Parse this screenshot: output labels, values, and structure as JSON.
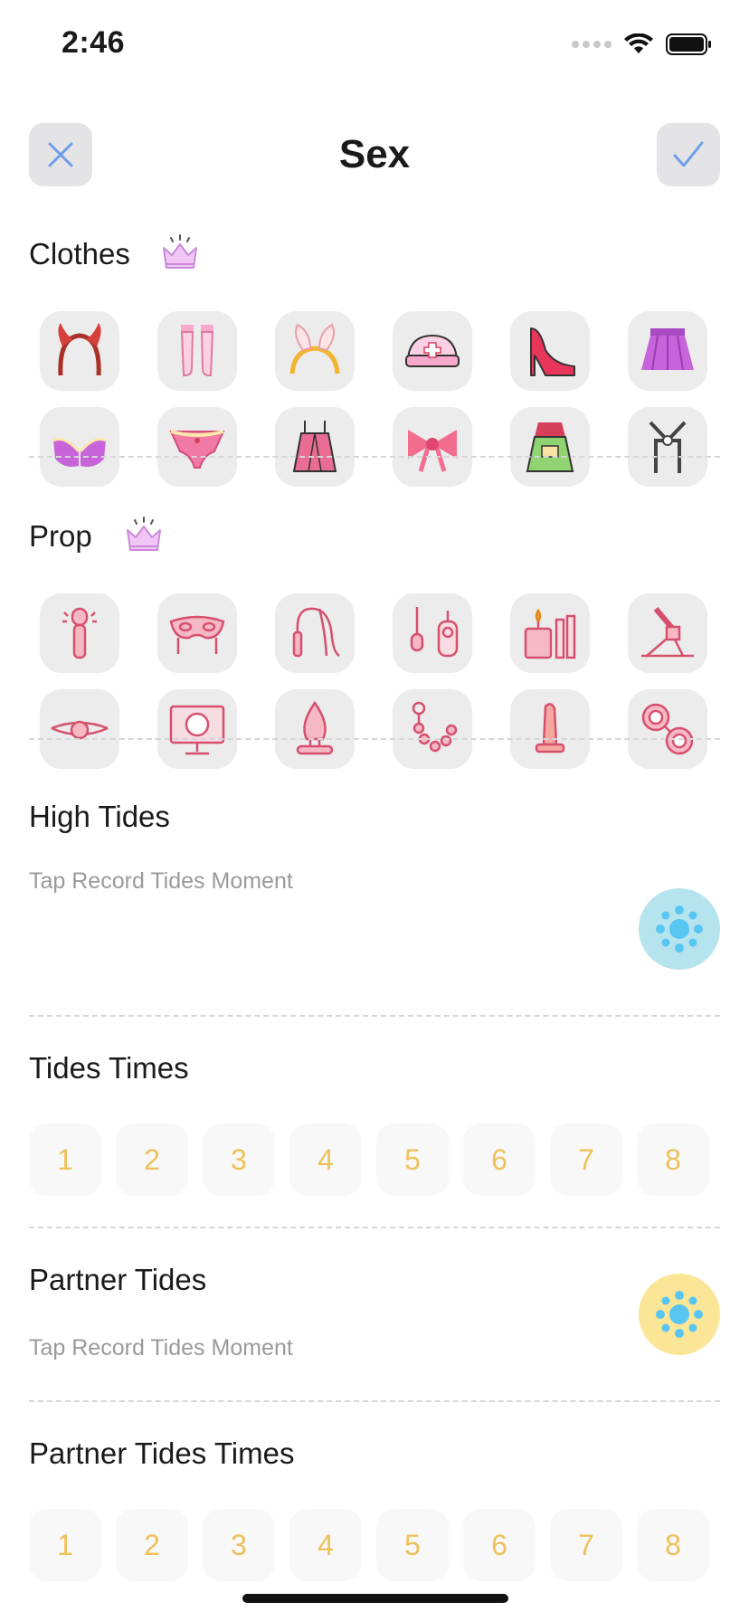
{
  "status_bar": {
    "time": "2:46"
  },
  "nav": {
    "title": "Sex",
    "close_icon": "close-icon",
    "confirm_icon": "checkmark-icon"
  },
  "clothes": {
    "label": "Clothes",
    "premium_icon": "crown-icon",
    "items": [
      {
        "name": "devil-horns-headband-icon"
      },
      {
        "name": "stockings-icon"
      },
      {
        "name": "bunny-ears-headband-icon"
      },
      {
        "name": "nurse-cap-icon"
      },
      {
        "name": "high-heel-icon"
      },
      {
        "name": "pleated-skirt-icon"
      },
      {
        "name": "bra-icon"
      },
      {
        "name": "panties-icon"
      },
      {
        "name": "lingerie-icon"
      },
      {
        "name": "bow-icon"
      },
      {
        "name": "maid-apron-icon"
      },
      {
        "name": "harness-icon"
      }
    ]
  },
  "prop": {
    "label": "Prop",
    "premium_icon": "crown-icon",
    "items": [
      {
        "name": "wand-massager-icon"
      },
      {
        "name": "eye-mask-icon"
      },
      {
        "name": "whip-icon"
      },
      {
        "name": "remote-vibrator-icon"
      },
      {
        "name": "candles-icon"
      },
      {
        "name": "machine-icon"
      },
      {
        "name": "ball-gag-icon"
      },
      {
        "name": "adult-video-icon"
      },
      {
        "name": "plug-icon"
      },
      {
        "name": "anal-beads-icon"
      },
      {
        "name": "dildo-icon"
      },
      {
        "name": "handcuffs-icon"
      }
    ]
  },
  "high_tides": {
    "label": "High Tides",
    "hint": "Tap Record Tides Moment",
    "button_icon": "splash-icon"
  },
  "tides_times": {
    "label": "Tides Times",
    "options": [
      "1",
      "2",
      "3",
      "4",
      "5",
      "6",
      "7",
      "8"
    ]
  },
  "partner_tides": {
    "label": "Partner Tides",
    "hint": "Tap Record Tides Moment",
    "button_icon": "splash-icon"
  },
  "partner_tides_times": {
    "label": "Partner Tides Times",
    "options": [
      "1",
      "2",
      "3",
      "4",
      "5",
      "6",
      "7",
      "8"
    ]
  },
  "colors": {
    "accent": "#6f9ee8",
    "number": "#eec15a",
    "tile": "#ececec",
    "crown": "#e6a8f2",
    "icon_pink": "#e07a8e"
  }
}
